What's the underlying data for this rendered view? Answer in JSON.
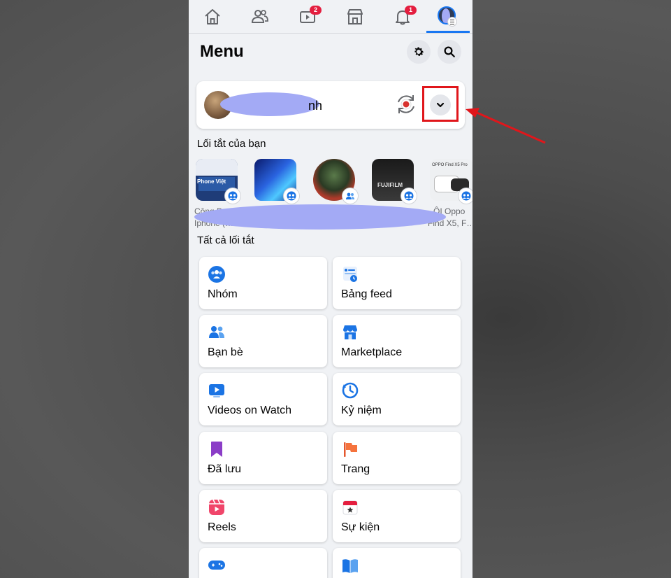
{
  "nav": {
    "items": [
      {
        "name": "home",
        "badge": ""
      },
      {
        "name": "friends",
        "badge": ""
      },
      {
        "name": "watch",
        "badge": "2"
      },
      {
        "name": "marketplace",
        "badge": ""
      },
      {
        "name": "notifications",
        "badge": "1"
      },
      {
        "name": "menu",
        "badge": ""
      }
    ],
    "active": "menu",
    "accent": "#1877f2",
    "badge_color": "#e41e3f"
  },
  "header": {
    "title": "Menu",
    "icons": [
      "settings-icon",
      "search-icon"
    ]
  },
  "profile": {
    "name_visible_tail": "nh",
    "name_redacted": true
  },
  "shortcuts": {
    "title": "Lối tắt của bạn",
    "items": [
      {
        "label": "Cộng Đ…",
        "subline": "Iphone (…",
        "thumb_text": "Phone Việt"
      },
      {
        "label": "",
        "subline": "",
        "thumb_text": ""
      },
      {
        "label": "",
        "subline": "",
        "thumb_text": ""
      },
      {
        "label": "",
        "subline": "",
        "thumb_text": "FUJIFILM"
      },
      {
        "label": "ỘI Oppo",
        "subline": "Find X5, F…",
        "thumb_text": "OPPO Find X5 Pro"
      }
    ],
    "labels_redacted": true
  },
  "all_shortcuts": {
    "title": "Tất cả lối tắt",
    "tiles": [
      {
        "label": "Nhóm",
        "icon": "groups-icon"
      },
      {
        "label": "Bảng feed",
        "icon": "feed-icon"
      },
      {
        "label": "Bạn bè",
        "icon": "friends-icon"
      },
      {
        "label": "Marketplace",
        "icon": "marketplace-icon"
      },
      {
        "label": "Videos on Watch",
        "icon": "watch-icon"
      },
      {
        "label": "Kỷ niệm",
        "icon": "memories-icon"
      },
      {
        "label": "Đã lưu",
        "icon": "saved-icon"
      },
      {
        "label": "Trang",
        "icon": "pages-icon"
      },
      {
        "label": "Reels",
        "icon": "reels-icon"
      },
      {
        "label": "Sự kiện",
        "icon": "events-icon"
      },
      {
        "label": "",
        "icon": "gaming-icon"
      },
      {
        "label": "",
        "icon": "feeds-book-icon"
      }
    ]
  },
  "annotation": {
    "highlight_color": "#e0161b",
    "target": "profile-switch-chevron"
  }
}
